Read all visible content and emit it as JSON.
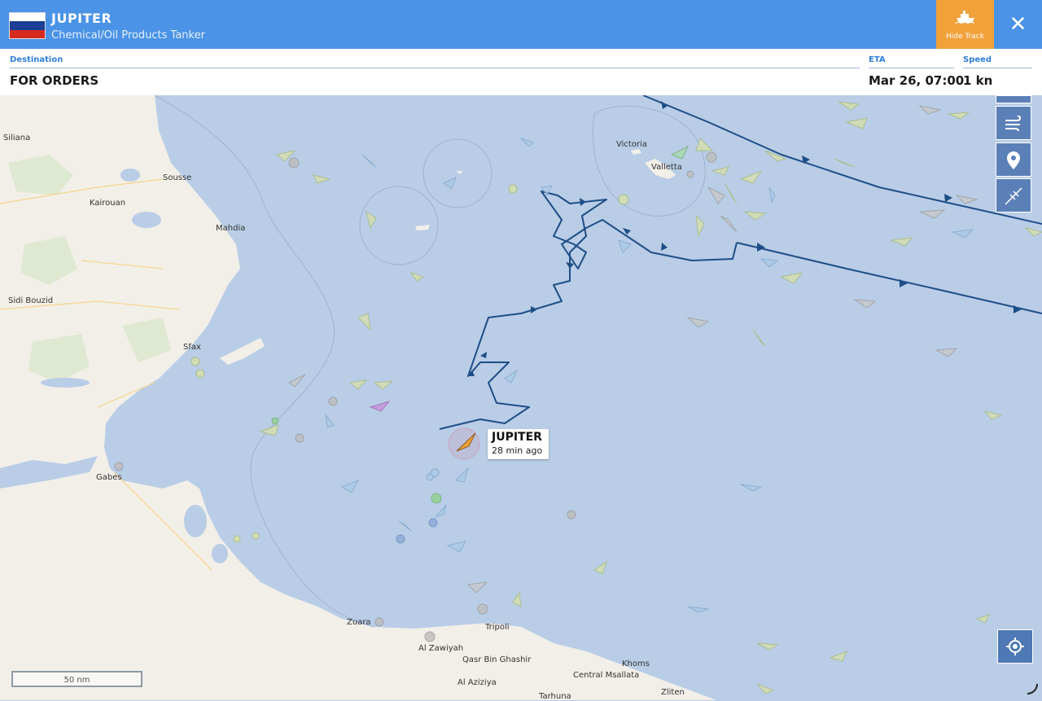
{
  "header": {
    "vessel_name": "JUPITER",
    "vessel_type": "Chemical/Oil Products Tanker",
    "flag_colors": [
      "#ffffff",
      "#1c3f95",
      "#d52b1e"
    ],
    "hide_track_label": "Hide Track",
    "close_icon": "close-icon"
  },
  "info": {
    "destination_label": "Destination",
    "destination_value": "FOR ORDERS",
    "eta_label": "ETA",
    "eta_value": "Mar 26, 07:00",
    "speed_label": "Speed",
    "speed_value": "1 kn"
  },
  "controls": [
    "layers-icon",
    "wind-icon",
    "location-pin-icon",
    "measure-icon",
    "my-location-icon"
  ],
  "vessel_label": {
    "name": "JUPITER",
    "age": "28 min ago"
  },
  "scale_bar": "50 nm",
  "places": {
    "siliana": "Siliana",
    "sousse": "Sousse",
    "kairouan": "Kairouan",
    "mahdia": "Mahdia",
    "sidi_bouzid": "Sidi Bouzid",
    "sfax": "Sfax",
    "gabes": "Gabes",
    "zuara": "Zuara",
    "tripoli": "Tripoli",
    "al_zawiyah": "Al Zawiyah",
    "qasr_bin_ghashir": "Qasr Bin Ghashir",
    "al_aziziya": "Al Aziziya",
    "tarhuna": "Tarhuna",
    "khoms": "Khoms",
    "central_msallata": "Central Msallata",
    "zliten": "Zliten",
    "victoria": "Victoria",
    "valletta": "Valletta"
  },
  "colors": {
    "sea": "#b9cde6",
    "land": "#f2efe9",
    "track": "#1e4e86",
    "header": "#4a93e6",
    "accent": "#f0a13a"
  }
}
